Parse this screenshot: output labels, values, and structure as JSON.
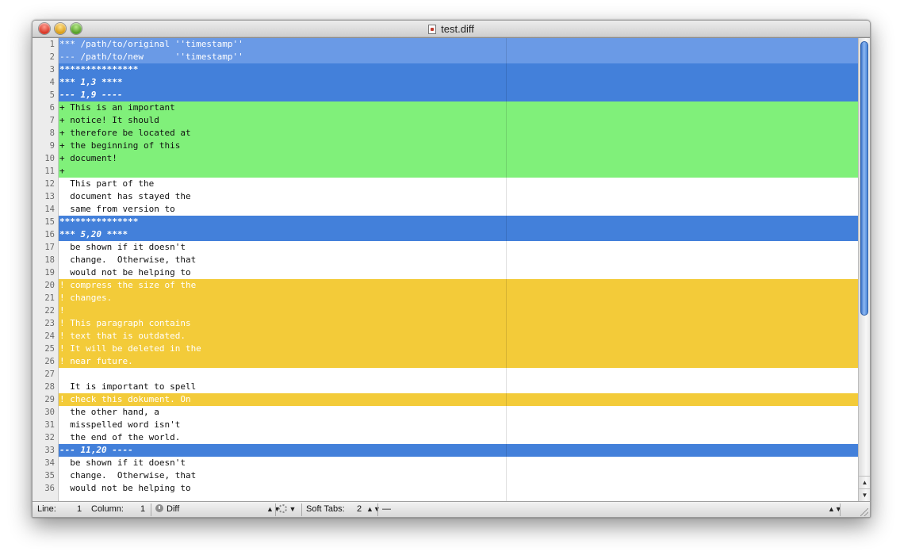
{
  "window": {
    "title": "test.diff"
  },
  "editor": {
    "lines": [
      {
        "n": "1",
        "text": "*** /path/to/original ''timestamp''",
        "kind": "hdr-light"
      },
      {
        "n": "2",
        "text": "--- /path/to/new      ''timestamp''",
        "kind": "hdr-light"
      },
      {
        "n": "3",
        "text": "***************",
        "kind": "stars"
      },
      {
        "n": "4",
        "text": "*** 1,3 ****",
        "kind": "hdr ital"
      },
      {
        "n": "5",
        "text": "--- 1,9 ----",
        "kind": "hdr ital"
      },
      {
        "n": "6",
        "text": "+ This is an important",
        "kind": "ins"
      },
      {
        "n": "7",
        "text": "+ notice! It should",
        "kind": "ins"
      },
      {
        "n": "8",
        "text": "+ therefore be located at",
        "kind": "ins"
      },
      {
        "n": "9",
        "text": "+ the beginning of this",
        "kind": "ins"
      },
      {
        "n": "10",
        "text": "+ document!",
        "kind": "ins"
      },
      {
        "n": "11",
        "text": "+",
        "kind": "ins"
      },
      {
        "n": "12",
        "text": "  This part of the",
        "kind": "plain"
      },
      {
        "n": "13",
        "text": "  document has stayed the",
        "kind": "plain"
      },
      {
        "n": "14",
        "text": "  same from version to",
        "kind": "plain"
      },
      {
        "n": "15",
        "text": "***************",
        "kind": "stars"
      },
      {
        "n": "16",
        "text": "*** 5,20 ****",
        "kind": "hdr ital"
      },
      {
        "n": "17",
        "text": "  be shown if it doesn't",
        "kind": "plain"
      },
      {
        "n": "18",
        "text": "  change.  Otherwise, that",
        "kind": "plain"
      },
      {
        "n": "19",
        "text": "  would not be helping to",
        "kind": "plain"
      },
      {
        "n": "20",
        "text": "! compress the size of the",
        "kind": "chg"
      },
      {
        "n": "21",
        "text": "! changes.",
        "kind": "chg"
      },
      {
        "n": "22",
        "text": "!",
        "kind": "chg"
      },
      {
        "n": "23",
        "text": "! This paragraph contains",
        "kind": "chg"
      },
      {
        "n": "24",
        "text": "! text that is outdated.",
        "kind": "chg"
      },
      {
        "n": "25",
        "text": "! It will be deleted in the",
        "kind": "chg"
      },
      {
        "n": "26",
        "text": "! near future.",
        "kind": "chg"
      },
      {
        "n": "27",
        "text": "",
        "kind": "plain"
      },
      {
        "n": "28",
        "text": "  It is important to spell",
        "kind": "plain"
      },
      {
        "n": "29",
        "text": "! check this dokument. On",
        "kind": "chg"
      },
      {
        "n": "30",
        "text": "  the other hand, a",
        "kind": "plain"
      },
      {
        "n": "31",
        "text": "  misspelled word isn't",
        "kind": "plain"
      },
      {
        "n": "32",
        "text": "  the end of the world.",
        "kind": "plain"
      },
      {
        "n": "33",
        "text": "--- 11,20 ----",
        "kind": "hdr ital"
      },
      {
        "n": "34",
        "text": "  be shown if it doesn't",
        "kind": "plain"
      },
      {
        "n": "35",
        "text": "  change.  Otherwise, that",
        "kind": "plain"
      },
      {
        "n": "36",
        "text": "  would not be helping to",
        "kind": "plain"
      }
    ]
  },
  "statusbar": {
    "line_label": "Line:",
    "line_value": "1",
    "column_label": "Column:",
    "column_value": "1",
    "language": "Diff",
    "soft_tabs_label": "Soft Tabs:",
    "soft_tabs_value": "2",
    "symbol": "—"
  },
  "colors": {
    "header_light": "#6a9ae6",
    "header": "#4380da",
    "insert": "#80f07a",
    "change": "#f3cb39"
  },
  "icons": {
    "close": "close-button-icon",
    "minimize": "minimize-button-icon",
    "zoom": "zoom-button-icon",
    "document": "diff-document-icon",
    "language": "clock-icon",
    "bundle": "gear-icon"
  }
}
